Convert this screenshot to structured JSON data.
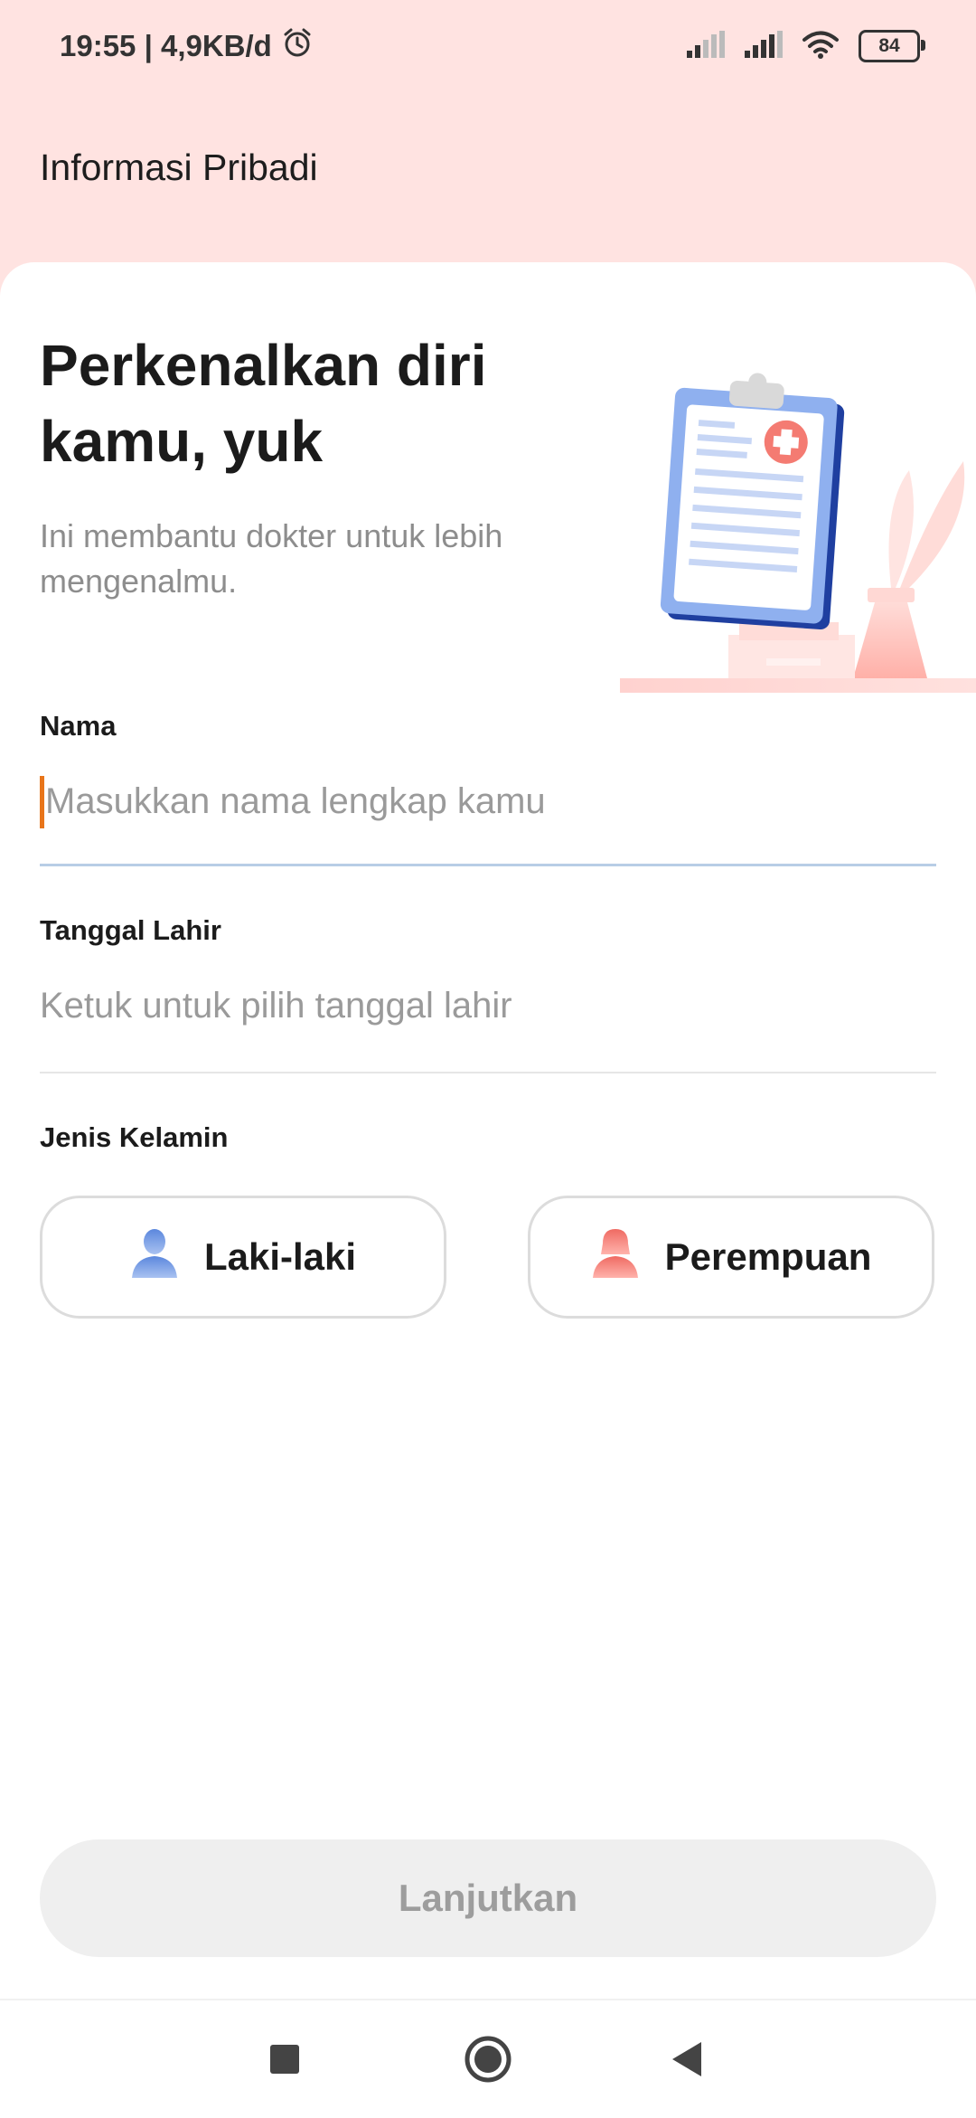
{
  "status_bar": {
    "time_speed": "19:55 | 4,9KB/d",
    "battery": "84",
    "icons": [
      "alarm-icon",
      "signal-icon",
      "signal-icon",
      "wifi-icon",
      "battery-icon"
    ]
  },
  "header": {
    "title": "Informasi Pribadi"
  },
  "intro": {
    "headline": "Perkenalkan diri kamu, yuk",
    "subtext": "Ini membantu dokter untuk lebih mengenalmu."
  },
  "form": {
    "name": {
      "label": "Nama",
      "placeholder": "Masukkan nama lengkap kamu",
      "value": ""
    },
    "birthdate": {
      "label": "Tanggal Lahir",
      "placeholder": "Ketuk untuk pilih tanggal lahir"
    },
    "gender": {
      "label": "Jenis Kelamin",
      "options": [
        {
          "label": "Laki-laki",
          "icon": "male-person-icon",
          "color": "#7aa3e8"
        },
        {
          "label": "Perempuan",
          "icon": "female-person-icon",
          "color": "#f3837c"
        }
      ]
    }
  },
  "footer": {
    "continue_label": "Lanjutkan"
  },
  "colors": {
    "header_bg": "#ffe3e1",
    "caret": "#e8751a",
    "active_underline": "#b8cde6",
    "disabled_button_bg": "#efefef",
    "disabled_button_text": "#9d9d9d"
  },
  "nav_bar": {
    "buttons": [
      "recents-square-icon",
      "home-circle-icon",
      "back-triangle-icon"
    ]
  }
}
